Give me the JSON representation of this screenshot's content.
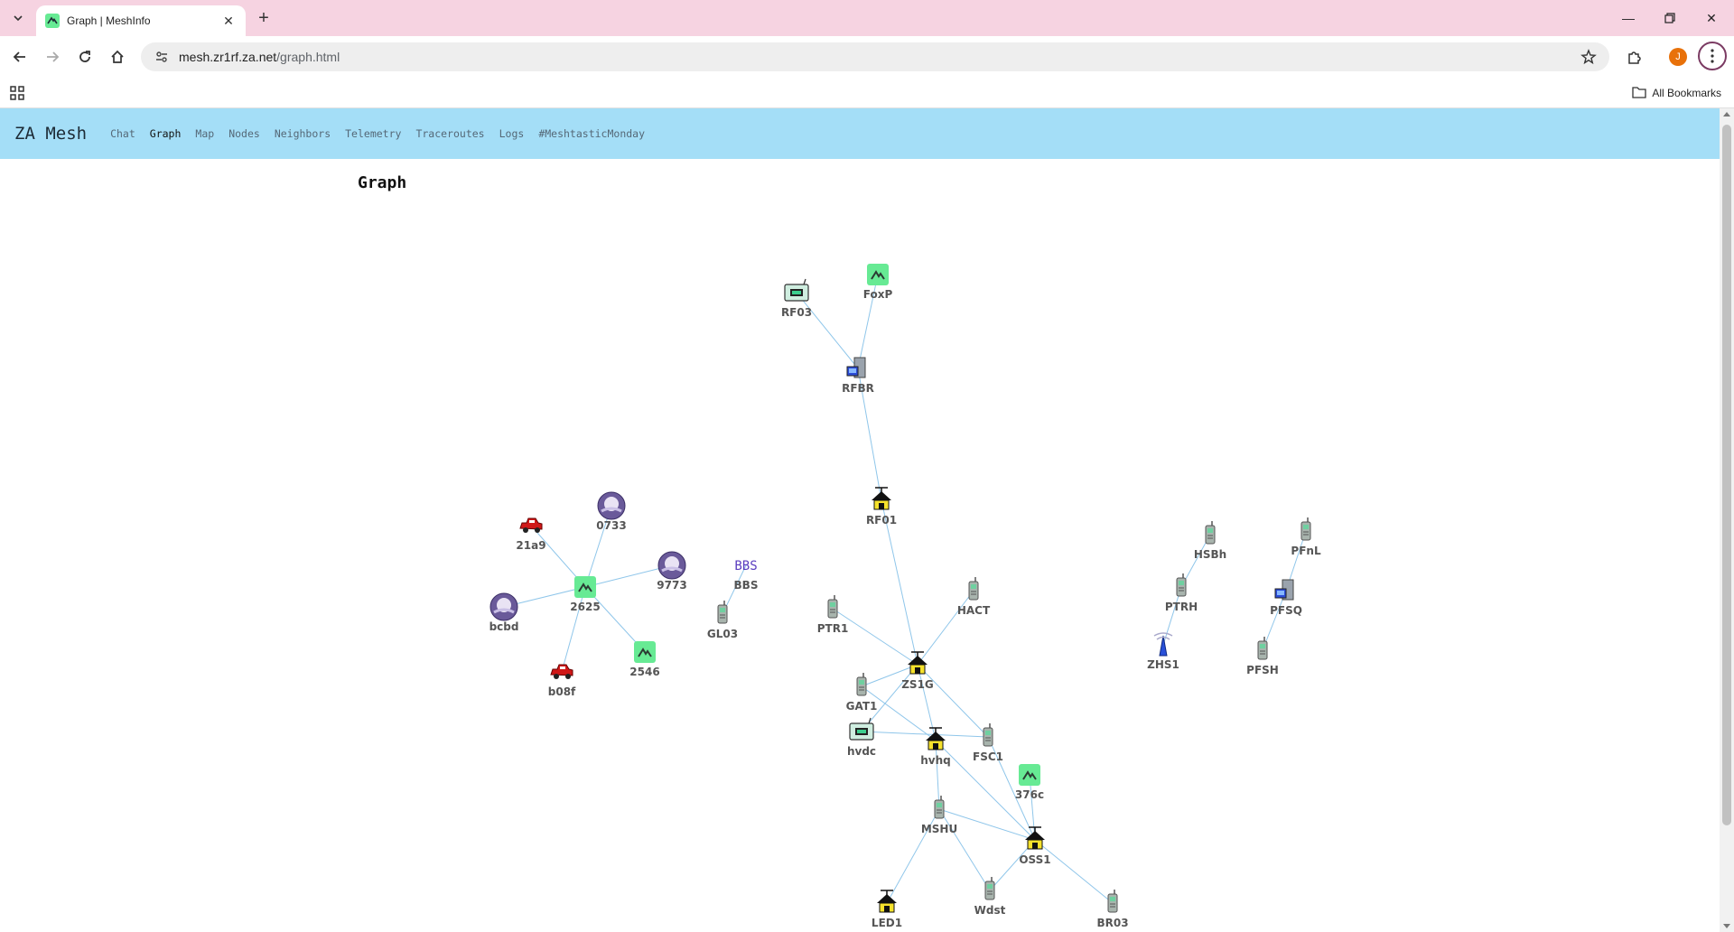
{
  "browser": {
    "tab_title": "Graph | MeshInfo",
    "url_host": "mesh.zr1rf.za.net",
    "url_path": "/graph.html",
    "profile_initial": "J",
    "all_bookmarks": "All Bookmarks"
  },
  "site": {
    "brand": "ZA Mesh",
    "nav": [
      "Chat",
      "Graph",
      "Map",
      "Nodes",
      "Neighbors",
      "Telemetry",
      "Traceroutes",
      "Logs",
      "#MeshtasticMonday"
    ],
    "active_nav": "Graph"
  },
  "page": {
    "title": "Graph"
  },
  "graph": {
    "nodes": [
      {
        "id": "RF03",
        "icon": "router-icon"
      },
      {
        "id": "FoxP",
        "icon": "meshtastic-icon"
      },
      {
        "id": "RFBR",
        "icon": "server-icon"
      },
      {
        "id": "RF01",
        "icon": "house-antenna-icon"
      },
      {
        "id": "0733",
        "icon": "avatar-icon"
      },
      {
        "id": "21a9",
        "icon": "car-icon"
      },
      {
        "id": "9773",
        "icon": "avatar-icon"
      },
      {
        "id": "2625",
        "icon": "meshtastic-icon"
      },
      {
        "id": "bcbd",
        "icon": "avatar-icon"
      },
      {
        "id": "2546",
        "icon": "meshtastic-icon"
      },
      {
        "id": "b08f",
        "icon": "car-icon"
      },
      {
        "id": "BBS",
        "icon": "bbs-icon"
      },
      {
        "id": "GL03",
        "icon": "handheld-icon"
      },
      {
        "id": "HACT",
        "icon": "handheld-icon"
      },
      {
        "id": "PTR1",
        "icon": "handheld-icon"
      },
      {
        "id": "ZS1G",
        "icon": "house-antenna-icon"
      },
      {
        "id": "GAT1",
        "icon": "handheld-icon"
      },
      {
        "id": "hvdc",
        "icon": "router-icon"
      },
      {
        "id": "hvhq",
        "icon": "house-antenna-icon"
      },
      {
        "id": "FSC1",
        "icon": "handheld-icon"
      },
      {
        "id": "376c",
        "icon": "meshtastic-icon"
      },
      {
        "id": "MSHU",
        "icon": "handheld-icon"
      },
      {
        "id": "OSS1",
        "icon": "house-antenna-icon"
      },
      {
        "id": "LED1",
        "icon": "house-antenna-icon"
      },
      {
        "id": "Wdst",
        "icon": "handheld-icon"
      },
      {
        "id": "BR03",
        "icon": "handheld-icon"
      },
      {
        "id": "HSBh",
        "icon": "handheld-icon"
      },
      {
        "id": "PFnL",
        "icon": "handheld-icon"
      },
      {
        "id": "PTRH",
        "icon": "handheld-icon"
      },
      {
        "id": "PFSQ",
        "icon": "server-icon"
      },
      {
        "id": "ZHS1",
        "icon": "tower-icon"
      },
      {
        "id": "PFSH",
        "icon": "handheld-icon"
      }
    ],
    "edges": [
      [
        "RF03",
        "RFBR"
      ],
      [
        "FoxP",
        "RFBR"
      ],
      [
        "RFBR",
        "RF01"
      ],
      [
        "RF01",
        "ZS1G"
      ],
      [
        "2625",
        "0733"
      ],
      [
        "2625",
        "21a9"
      ],
      [
        "2625",
        "9773"
      ],
      [
        "2625",
        "bcbd"
      ],
      [
        "2625",
        "2546"
      ],
      [
        "2625",
        "b08f"
      ],
      [
        "BBS",
        "GL03"
      ],
      [
        "PTR1",
        "ZS1G"
      ],
      [
        "HACT",
        "ZS1G"
      ],
      [
        "ZS1G",
        "GAT1"
      ],
      [
        "ZS1G",
        "hvdc"
      ],
      [
        "ZS1G",
        "hvhq"
      ],
      [
        "ZS1G",
        "FSC1"
      ],
      [
        "GAT1",
        "hvhq"
      ],
      [
        "hvdc",
        "FSC1"
      ],
      [
        "hvhq",
        "MSHU"
      ],
      [
        "hvhq",
        "OSS1"
      ],
      [
        "FSC1",
        "OSS1"
      ],
      [
        "376c",
        "OSS1"
      ],
      [
        "MSHU",
        "OSS1"
      ],
      [
        "MSHU",
        "LED1"
      ],
      [
        "MSHU",
        "Wdst"
      ],
      [
        "OSS1",
        "Wdst"
      ],
      [
        "OSS1",
        "BR03"
      ],
      [
        "HSBh",
        "PTRH"
      ],
      [
        "PTRH",
        "ZHS1"
      ],
      [
        "PFnL",
        "PFSQ"
      ],
      [
        "PFSQ",
        "PFSH"
      ]
    ]
  }
}
